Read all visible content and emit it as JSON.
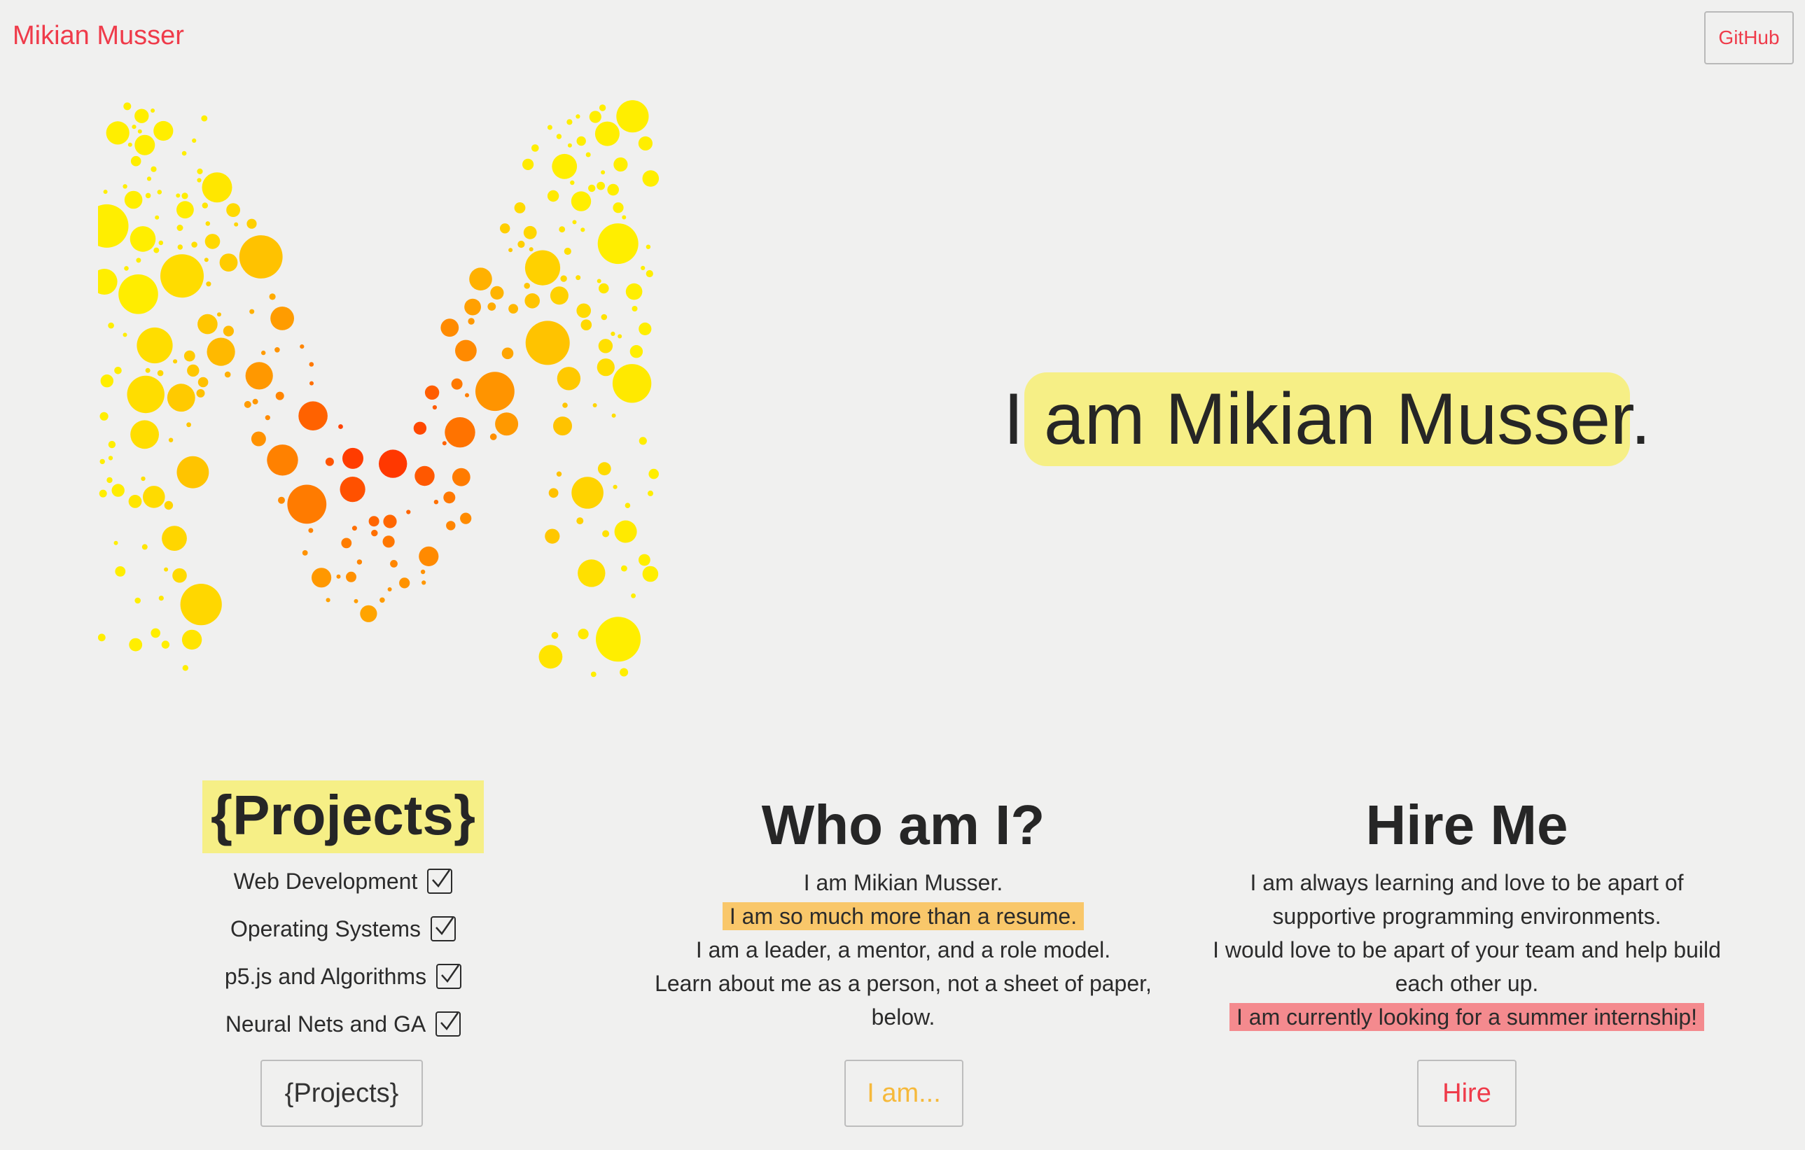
{
  "nav": {
    "brand": "Mikian Musser",
    "github_label": "GitHub"
  },
  "hero": {
    "text": "I am Mikian Musser."
  },
  "colors": {
    "accent_red": "#ef3b4a",
    "highlight_yellow": "#f6ef86",
    "highlight_orange": "#f9c76a",
    "highlight_red": "#f48a8e",
    "button_orange": "#f6b93b"
  },
  "logo": {
    "letter": "M",
    "style": "bubble-dots",
    "gradient": [
      "#ffee00",
      "#ffbf00",
      "#ff7a00",
      "#ff1a00"
    ]
  },
  "projects": {
    "title": "{Projects}",
    "items": [
      {
        "label": "Web Development",
        "checked": true
      },
      {
        "label": "Operating Systems",
        "checked": true
      },
      {
        "label": "p5.js and Algorithms",
        "checked": true
      },
      {
        "label": "Neural Nets and GA",
        "checked": true
      }
    ],
    "button_label": "{Projects}"
  },
  "who": {
    "title": "Who am I?",
    "line1": "I am Mikian Musser.",
    "line2_highlight": "I am so much more than a resume.",
    "line3": "I am a leader, a mentor, and a role model.",
    "line4": "Learn about me as a person, not a sheet of paper,",
    "line5": "below.",
    "button_label": "I am..."
  },
  "hire": {
    "title": "Hire Me",
    "line1": "I am always learning and love to be apart of",
    "line2": "supportive programming environments.",
    "line3": "I would love to be apart of your team and help build",
    "line4": "each other up.",
    "line5_highlight": "I am currently looking for a summer internship!",
    "button_label": "Hire"
  }
}
